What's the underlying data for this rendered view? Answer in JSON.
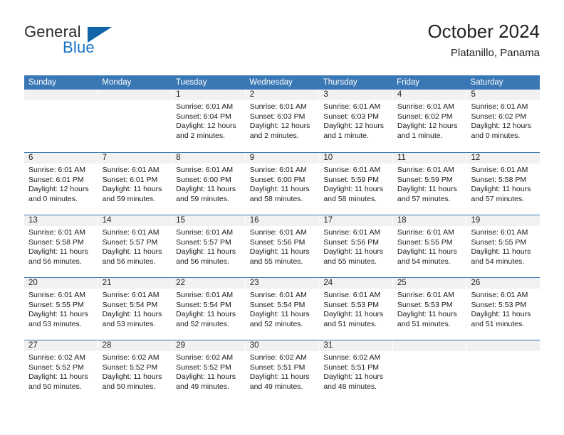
{
  "logo": {
    "word1": "General",
    "word2": "Blue",
    "triangle_color": "#1263a8",
    "word2_color": "#1573c4"
  },
  "header": {
    "title": "October 2024",
    "subtitle": "Platanillo, Panama"
  },
  "colors": {
    "header_blue": "#3a78b5",
    "daynum_band": "#f1f1f1",
    "text": "#1a1a1a"
  },
  "weekdays": [
    "Sunday",
    "Monday",
    "Tuesday",
    "Wednesday",
    "Thursday",
    "Friday",
    "Saturday"
  ],
  "weeks": [
    [
      {
        "day": "",
        "sunrise": "",
        "sunset": "",
        "daylight1": "",
        "daylight2": ""
      },
      {
        "day": "",
        "sunrise": "",
        "sunset": "",
        "daylight1": "",
        "daylight2": ""
      },
      {
        "day": "1",
        "sunrise": "Sunrise: 6:01 AM",
        "sunset": "Sunset: 6:04 PM",
        "daylight1": "Daylight: 12 hours",
        "daylight2": "and 2 minutes."
      },
      {
        "day": "2",
        "sunrise": "Sunrise: 6:01 AM",
        "sunset": "Sunset: 6:03 PM",
        "daylight1": "Daylight: 12 hours",
        "daylight2": "and 2 minutes."
      },
      {
        "day": "3",
        "sunrise": "Sunrise: 6:01 AM",
        "sunset": "Sunset: 6:03 PM",
        "daylight1": "Daylight: 12 hours",
        "daylight2": "and 1 minute."
      },
      {
        "day": "4",
        "sunrise": "Sunrise: 6:01 AM",
        "sunset": "Sunset: 6:02 PM",
        "daylight1": "Daylight: 12 hours",
        "daylight2": "and 1 minute."
      },
      {
        "day": "5",
        "sunrise": "Sunrise: 6:01 AM",
        "sunset": "Sunset: 6:02 PM",
        "daylight1": "Daylight: 12 hours",
        "daylight2": "and 0 minutes."
      }
    ],
    [
      {
        "day": "6",
        "sunrise": "Sunrise: 6:01 AM",
        "sunset": "Sunset: 6:01 PM",
        "daylight1": "Daylight: 12 hours",
        "daylight2": "and 0 minutes."
      },
      {
        "day": "7",
        "sunrise": "Sunrise: 6:01 AM",
        "sunset": "Sunset: 6:01 PM",
        "daylight1": "Daylight: 11 hours",
        "daylight2": "and 59 minutes."
      },
      {
        "day": "8",
        "sunrise": "Sunrise: 6:01 AM",
        "sunset": "Sunset: 6:00 PM",
        "daylight1": "Daylight: 11 hours",
        "daylight2": "and 59 minutes."
      },
      {
        "day": "9",
        "sunrise": "Sunrise: 6:01 AM",
        "sunset": "Sunset: 6:00 PM",
        "daylight1": "Daylight: 11 hours",
        "daylight2": "and 58 minutes."
      },
      {
        "day": "10",
        "sunrise": "Sunrise: 6:01 AM",
        "sunset": "Sunset: 5:59 PM",
        "daylight1": "Daylight: 11 hours",
        "daylight2": "and 58 minutes."
      },
      {
        "day": "11",
        "sunrise": "Sunrise: 6:01 AM",
        "sunset": "Sunset: 5:59 PM",
        "daylight1": "Daylight: 11 hours",
        "daylight2": "and 57 minutes."
      },
      {
        "day": "12",
        "sunrise": "Sunrise: 6:01 AM",
        "sunset": "Sunset: 5:58 PM",
        "daylight1": "Daylight: 11 hours",
        "daylight2": "and 57 minutes."
      }
    ],
    [
      {
        "day": "13",
        "sunrise": "Sunrise: 6:01 AM",
        "sunset": "Sunset: 5:58 PM",
        "daylight1": "Daylight: 11 hours",
        "daylight2": "and 56 minutes."
      },
      {
        "day": "14",
        "sunrise": "Sunrise: 6:01 AM",
        "sunset": "Sunset: 5:57 PM",
        "daylight1": "Daylight: 11 hours",
        "daylight2": "and 56 minutes."
      },
      {
        "day": "15",
        "sunrise": "Sunrise: 6:01 AM",
        "sunset": "Sunset: 5:57 PM",
        "daylight1": "Daylight: 11 hours",
        "daylight2": "and 56 minutes."
      },
      {
        "day": "16",
        "sunrise": "Sunrise: 6:01 AM",
        "sunset": "Sunset: 5:56 PM",
        "daylight1": "Daylight: 11 hours",
        "daylight2": "and 55 minutes."
      },
      {
        "day": "17",
        "sunrise": "Sunrise: 6:01 AM",
        "sunset": "Sunset: 5:56 PM",
        "daylight1": "Daylight: 11 hours",
        "daylight2": "and 55 minutes."
      },
      {
        "day": "18",
        "sunrise": "Sunrise: 6:01 AM",
        "sunset": "Sunset: 5:55 PM",
        "daylight1": "Daylight: 11 hours",
        "daylight2": "and 54 minutes."
      },
      {
        "day": "19",
        "sunrise": "Sunrise: 6:01 AM",
        "sunset": "Sunset: 5:55 PM",
        "daylight1": "Daylight: 11 hours",
        "daylight2": "and 54 minutes."
      }
    ],
    [
      {
        "day": "20",
        "sunrise": "Sunrise: 6:01 AM",
        "sunset": "Sunset: 5:55 PM",
        "daylight1": "Daylight: 11 hours",
        "daylight2": "and 53 minutes."
      },
      {
        "day": "21",
        "sunrise": "Sunrise: 6:01 AM",
        "sunset": "Sunset: 5:54 PM",
        "daylight1": "Daylight: 11 hours",
        "daylight2": "and 53 minutes."
      },
      {
        "day": "22",
        "sunrise": "Sunrise: 6:01 AM",
        "sunset": "Sunset: 5:54 PM",
        "daylight1": "Daylight: 11 hours",
        "daylight2": "and 52 minutes."
      },
      {
        "day": "23",
        "sunrise": "Sunrise: 6:01 AM",
        "sunset": "Sunset: 5:54 PM",
        "daylight1": "Daylight: 11 hours",
        "daylight2": "and 52 minutes."
      },
      {
        "day": "24",
        "sunrise": "Sunrise: 6:01 AM",
        "sunset": "Sunset: 5:53 PM",
        "daylight1": "Daylight: 11 hours",
        "daylight2": "and 51 minutes."
      },
      {
        "day": "25",
        "sunrise": "Sunrise: 6:01 AM",
        "sunset": "Sunset: 5:53 PM",
        "daylight1": "Daylight: 11 hours",
        "daylight2": "and 51 minutes."
      },
      {
        "day": "26",
        "sunrise": "Sunrise: 6:01 AM",
        "sunset": "Sunset: 5:53 PM",
        "daylight1": "Daylight: 11 hours",
        "daylight2": "and 51 minutes."
      }
    ],
    [
      {
        "day": "27",
        "sunrise": "Sunrise: 6:02 AM",
        "sunset": "Sunset: 5:52 PM",
        "daylight1": "Daylight: 11 hours",
        "daylight2": "and 50 minutes."
      },
      {
        "day": "28",
        "sunrise": "Sunrise: 6:02 AM",
        "sunset": "Sunset: 5:52 PM",
        "daylight1": "Daylight: 11 hours",
        "daylight2": "and 50 minutes."
      },
      {
        "day": "29",
        "sunrise": "Sunrise: 6:02 AM",
        "sunset": "Sunset: 5:52 PM",
        "daylight1": "Daylight: 11 hours",
        "daylight2": "and 49 minutes."
      },
      {
        "day": "30",
        "sunrise": "Sunrise: 6:02 AM",
        "sunset": "Sunset: 5:51 PM",
        "daylight1": "Daylight: 11 hours",
        "daylight2": "and 49 minutes."
      },
      {
        "day": "31",
        "sunrise": "Sunrise: 6:02 AM",
        "sunset": "Sunset: 5:51 PM",
        "daylight1": "Daylight: 11 hours",
        "daylight2": "and 48 minutes."
      },
      {
        "day": "",
        "sunrise": "",
        "sunset": "",
        "daylight1": "",
        "daylight2": ""
      },
      {
        "day": "",
        "sunrise": "",
        "sunset": "",
        "daylight1": "",
        "daylight2": ""
      }
    ]
  ]
}
